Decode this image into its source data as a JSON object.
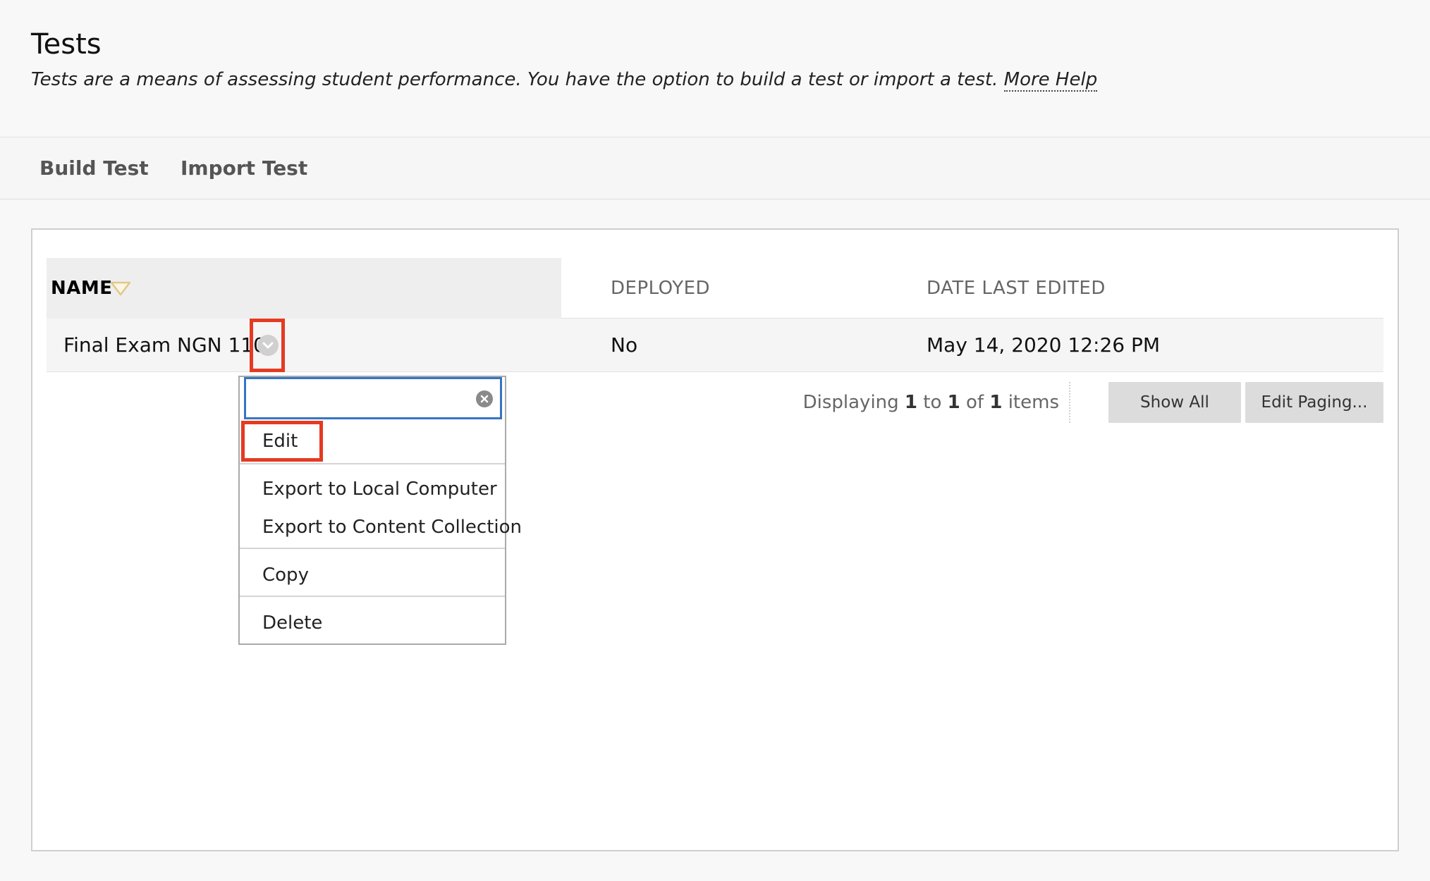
{
  "header": {
    "title": "Tests",
    "description": "Tests are a means of assessing student performance. You have the option to build a test or import a test.",
    "help_link": "More Help"
  },
  "actions": {
    "build": "Build Test",
    "import": "Import Test"
  },
  "table": {
    "columns": {
      "name": "NAME",
      "deployed": "DEPLOYED",
      "date": "DATE LAST EDITED"
    },
    "rows": [
      {
        "name": "Final Exam NGN 110",
        "deployed": "No",
        "date": "May 14, 2020 12:26 PM"
      }
    ]
  },
  "paging": {
    "prefix": "Displaying",
    "from": "1",
    "to_word": "to",
    "to": "1",
    "of_word": "of",
    "total": "1",
    "suffix": "items",
    "show_all": "Show All",
    "edit_paging": "Edit Paging..."
  },
  "context_menu": {
    "search_value": "",
    "items": {
      "edit": "Edit",
      "export_local": "Export to Local Computer",
      "export_collection": "Export to Content Collection",
      "copy": "Copy",
      "delete": "Delete"
    }
  },
  "colors": {
    "highlight": "#e53a22",
    "focus": "#3574c4",
    "sort_icon": "#e2c88a"
  }
}
